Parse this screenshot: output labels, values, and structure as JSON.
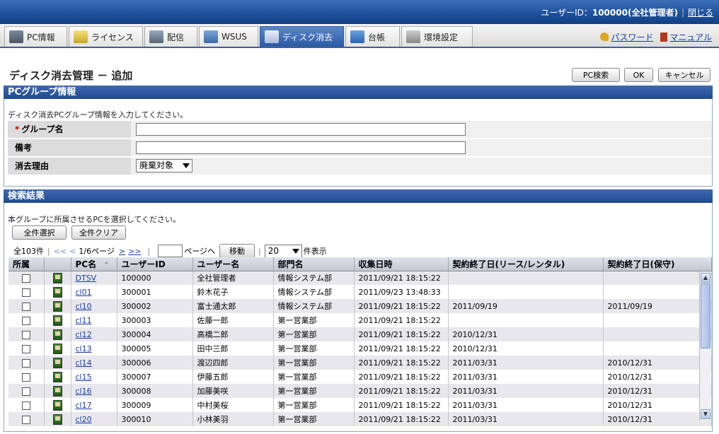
{
  "header": {
    "user_label": "ユーザーID：",
    "user_value": "100000(全社管理者)",
    "close_label": "閉じる"
  },
  "tabs": [
    {
      "label": "PC情報",
      "icon": "pc-icon"
    },
    {
      "label": "ライセンス",
      "icon": "license-icon"
    },
    {
      "label": "配信",
      "icon": "distribution-icon"
    },
    {
      "label": "WSUS",
      "icon": "wsus-icon"
    },
    {
      "label": "ディスク消去",
      "icon": "disk-erase-icon",
      "active": true
    },
    {
      "label": "台帳",
      "icon": "ledger-icon"
    },
    {
      "label": "環境設定",
      "icon": "settings-icon"
    }
  ],
  "toplinks": {
    "password": "パスワード",
    "manual": "マニュアル"
  },
  "page": {
    "title": "ディスク消去管理 － 追加",
    "btn_pcsearch": "PC検索",
    "btn_ok": "OK",
    "btn_cancel": "キャンセル"
  },
  "group_panel": {
    "title": "PCグループ情報",
    "hint": "ディスク消去PCグループ情報を入力してください。",
    "required_mark": "*",
    "group_name_label": "グループ名",
    "group_name_value": "",
    "remarks_label": "備考",
    "remarks_value": "",
    "reason_label": "消去理由",
    "reason_value": "廃棄対象"
  },
  "results_panel": {
    "title": "検索結果",
    "hint": "本グループに所属させるPCを選択してください。",
    "btn_select_all": "全件選択",
    "btn_clear_all": "全件クリア",
    "total": "全103件",
    "first": "<<",
    "prev": "<",
    "page_info": "1/6ページ",
    "next": ">",
    "last": ">>",
    "page_input": "",
    "page_to_label": "ページへ",
    "btn_move": "移動",
    "per_page": "20",
    "per_page_suffix": "件表示"
  },
  "columns": [
    "所属",
    "",
    "PC名",
    "ユーザーID",
    "ユーザー名",
    "部門名",
    "収集日時",
    "契約終了日(リース/レンタル)",
    "契約終了日(保守)"
  ],
  "sort_indicator": "⌃",
  "rows": [
    {
      "pc": "DTSV",
      "uid": "100000",
      "name": "全社管理者",
      "dept": "情報システム部",
      "date": "2011/09/21 18:15:22",
      "lease": "",
      "maint": ""
    },
    {
      "pc": "cl01",
      "uid": "300001",
      "name": "鈴木花子",
      "dept": "情報システム部",
      "date": "2011/09/23 13:48:33",
      "lease": "",
      "maint": ""
    },
    {
      "pc": "cl10",
      "uid": "300002",
      "name": "富士通太郎",
      "dept": "情報システム部",
      "date": "2011/09/21 18:15:22",
      "lease": "2011/09/19",
      "maint": "2011/09/19"
    },
    {
      "pc": "cl11",
      "uid": "300003",
      "name": "佐藤一郎",
      "dept": "第一営業部",
      "date": "2011/09/21 18:15:22",
      "lease": "",
      "maint": ""
    },
    {
      "pc": "cl12",
      "uid": "300004",
      "name": "高橋二郎",
      "dept": "第一営業部",
      "date": "2011/09/21 18:15:22",
      "lease": "2010/12/31",
      "maint": ""
    },
    {
      "pc": "cl13",
      "uid": "300005",
      "name": "田中三郎",
      "dept": "第一営業部",
      "date": "2011/09/21 18:15:22",
      "lease": "2010/12/31",
      "maint": ""
    },
    {
      "pc": "cl14",
      "uid": "300006",
      "name": "渡辺四郎",
      "dept": "第一営業部",
      "date": "2011/09/21 18:15:22",
      "lease": "2011/03/31",
      "maint": "2010/12/31"
    },
    {
      "pc": "cl15",
      "uid": "300007",
      "name": "伊藤五郎",
      "dept": "第一営業部",
      "date": "2011/09/21 18:15:22",
      "lease": "2011/03/31",
      "maint": "2010/12/31"
    },
    {
      "pc": "cl16",
      "uid": "300008",
      "name": "加藤美咲",
      "dept": "第一営業部",
      "date": "2011/09/21 18:15:22",
      "lease": "2011/03/31",
      "maint": "2010/12/31"
    },
    {
      "pc": "cl17",
      "uid": "300009",
      "name": "中村美桜",
      "dept": "第一営業部",
      "date": "2011/09/21 18:15:22",
      "lease": "2011/03/31",
      "maint": "2010/12/31"
    },
    {
      "pc": "cl20",
      "uid": "300010",
      "name": "小林美羽",
      "dept": "第一営業部",
      "date": "2011/09/21 18:15:22",
      "lease": "2011/03/31",
      "maint": "2010/12/31"
    }
  ],
  "colors": {
    "header_blue": "#1d4f9a",
    "link": "#1a3aa8",
    "required": "#dd0000"
  }
}
